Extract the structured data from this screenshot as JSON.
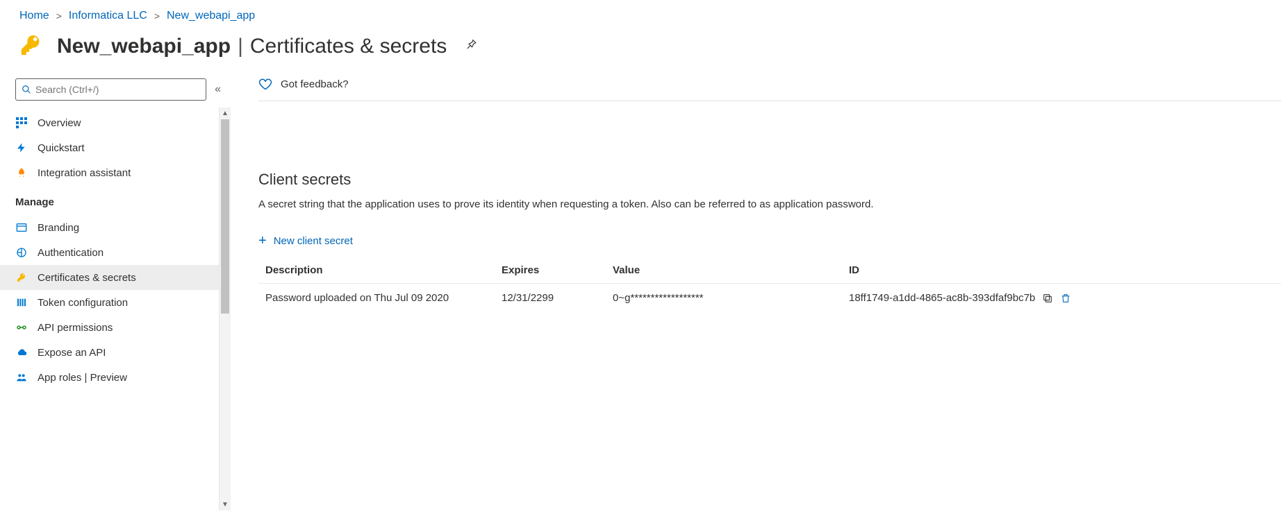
{
  "breadcrumb": {
    "home": "Home",
    "org": "Informatica LLC",
    "app": "New_webapi_app"
  },
  "header": {
    "app_name": "New_webapi_app",
    "pipe": "|",
    "page_name": "Certificates & secrets"
  },
  "sidebar": {
    "search_placeholder": "Search (Ctrl+/)",
    "items": {
      "overview": "Overview",
      "quickstart": "Quickstart",
      "integration": "Integration assistant"
    },
    "group_manage": "Manage",
    "manage_items": {
      "branding": "Branding",
      "authentication": "Authentication",
      "certificates": "Certificates & secrets",
      "token": "Token configuration",
      "api_perm": "API permissions",
      "expose": "Expose an API",
      "app_roles": "App roles | Preview"
    }
  },
  "content": {
    "feedback": "Got feedback?",
    "section_title": "Client secrets",
    "section_desc": "A secret string that the application uses to prove its identity when requesting a token. Also can be referred to as application password.",
    "new_secret": "New client secret",
    "table": {
      "headers": {
        "desc": "Description",
        "expires": "Expires",
        "value": "Value",
        "id": "ID"
      },
      "row0": {
        "desc": "Password uploaded on Thu Jul 09 2020",
        "expires": "12/31/2299",
        "value": "0~g******************",
        "id": "18ff1749-a1dd-4865-ac8b-393dfaf9bc7b"
      }
    }
  }
}
